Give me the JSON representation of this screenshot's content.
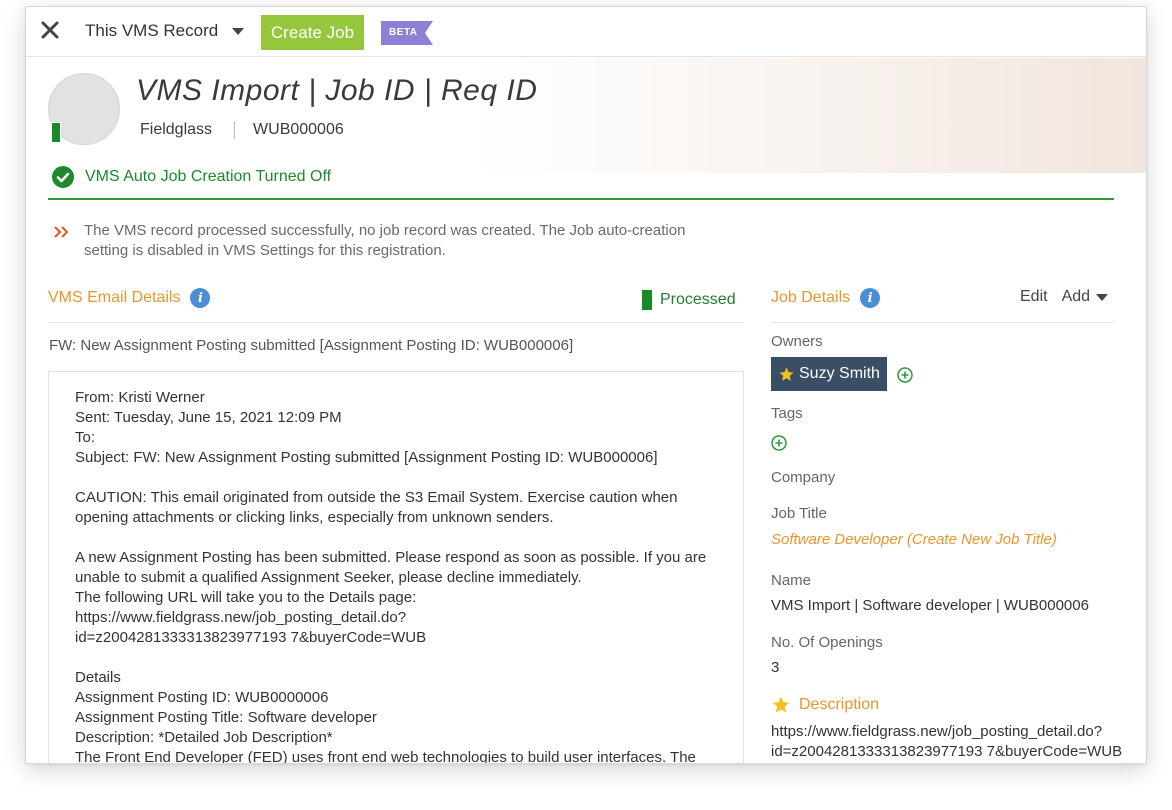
{
  "topbar": {
    "record_selector": "This VMS Record",
    "create_job": "Create Job",
    "beta": "BETA"
  },
  "header": {
    "title": "VMS Import | Job ID | Req ID",
    "source": "Fieldglass",
    "record_id": "WUB000006"
  },
  "status": {
    "auto_job": "VMS Auto Job Creation Turned Off",
    "message": "The VMS record processed successfully, no job record was created. The Job auto-creation setting is disabled in VMS Settings for this registration."
  },
  "email": {
    "section_title": "VMS Email Details",
    "state": "Processed",
    "subject": "FW: New Assignment Posting submitted [Assignment Posting ID: WUB000006]",
    "lines": {
      "from": "From: Kristi Werner",
      "sent": "Sent: Tuesday, June 15, 2021 12:09 PM",
      "to": "To:",
      "subject": "Subject: FW: New Assignment Posting submitted [Assignment Posting ID: WUB000006]",
      "caution": "CAUTION: This email originated from outside the S3 Email System. Exercise caution when opening attachments or clicking links, especially from unknown senders.",
      "intro": "A new Assignment Posting has been submitted. Please respond as soon as possible. If you are unable to submit a qualified Assignment Seeker, please decline immediately.",
      "url_intro": "The following URL will take you to the Details page:",
      "url_1": "https://www.fieldgrass.new/job_posting_detail.do?",
      "url_2": "id=z2004281333313823977193 7&buyerCode=WUB",
      "details": "Details",
      "posting_id": "Assignment Posting ID: WUB0000006",
      "posting_title": "Assignment Posting Title: Software developer",
      "description": "Description: *Detailed Job Description*",
      "description_body": "The Front End Developer (FED) uses front end web technologies to build user interfaces. The"
    }
  },
  "job": {
    "section_title": "Job Details",
    "edit": "Edit",
    "add": "Add",
    "owners_label": "Owners",
    "owner": "Suzy Smith",
    "tags_label": "Tags",
    "company_label": "Company",
    "job_title_label": "Job Title",
    "job_title_value": "Software Developer (Create New Job Title)",
    "name_label": "Name",
    "name_value": "VMS Import | Software developer | WUB000006",
    "openings_label": "No. Of Openings",
    "openings_value": "3",
    "description_label": "Description",
    "description_url_1": "https://www.fieldgrass.new/job_posting_detail.do?",
    "description_url_2": "id=z2004281333313823977193 7&buyerCode=WUB"
  }
}
